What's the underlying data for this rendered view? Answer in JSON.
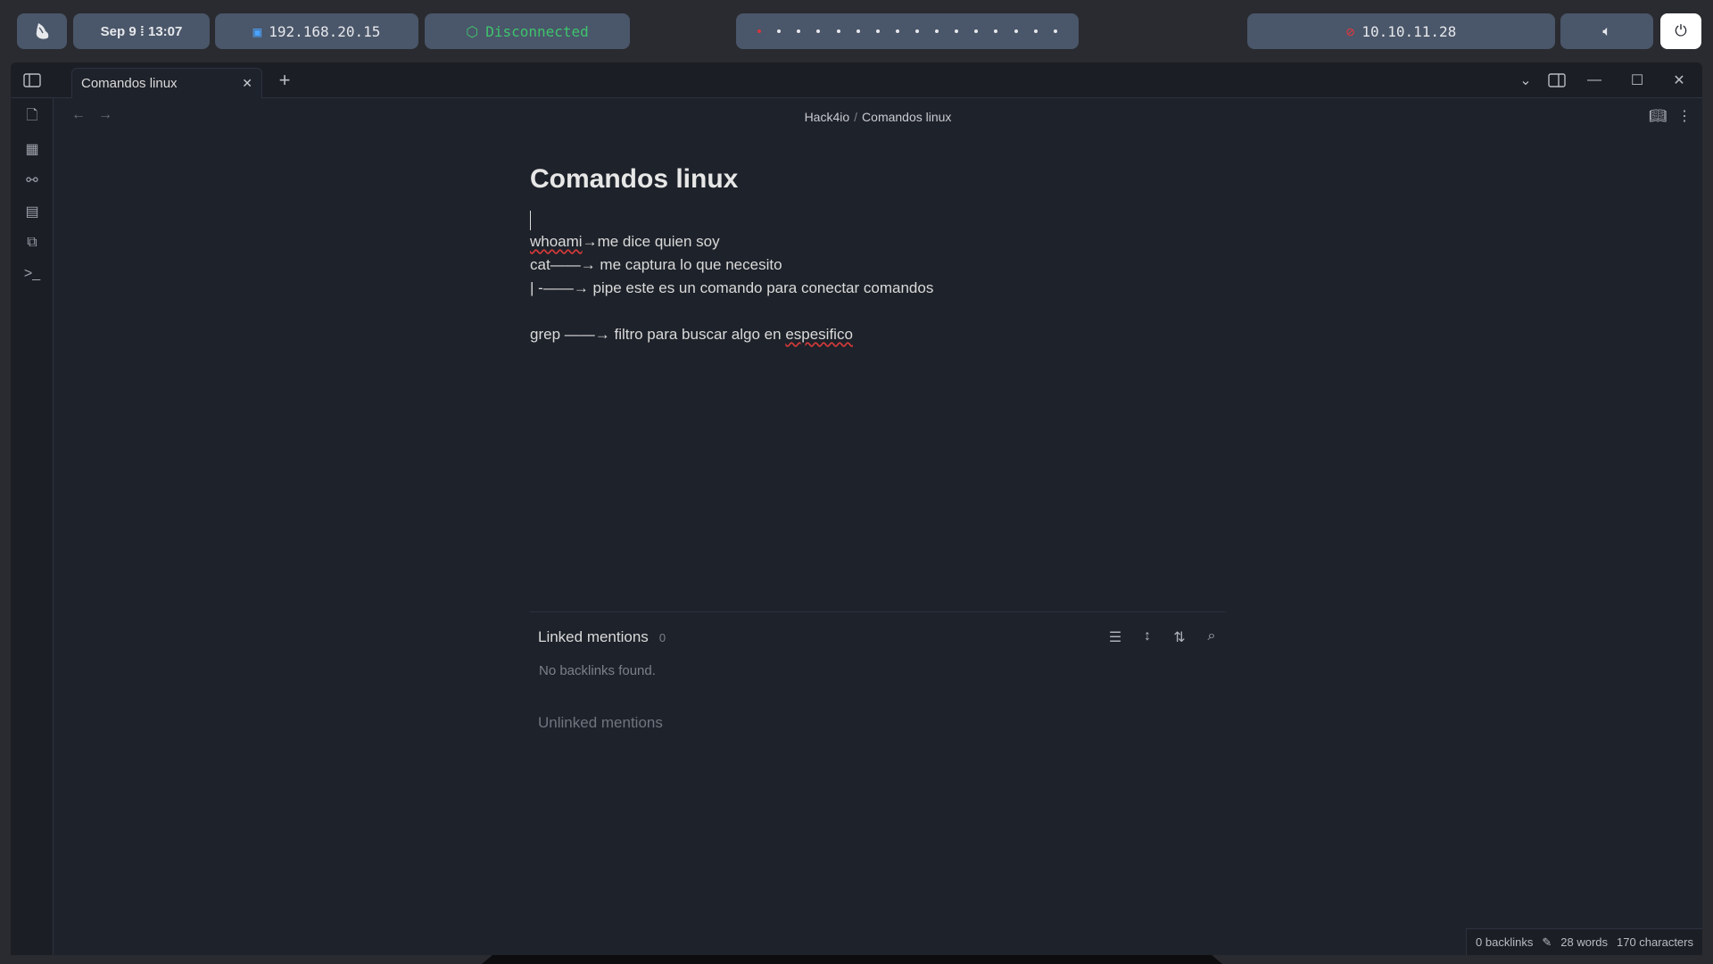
{
  "topbar": {
    "date": "Sep 9 ⁞ 13:07",
    "local_ip": "192.168.20.15",
    "vpn_status": "Disconnected",
    "target_ip": "10.10.11.28",
    "workspace_count": 16
  },
  "tab": {
    "title": "Comandos linux"
  },
  "breadcrumb": {
    "vault": "Hack4io",
    "separator": "/",
    "note": "Comandos linux"
  },
  "note": {
    "title": "Comandos linux",
    "lines": [
      {
        "cmd": "whoami",
        "rest": "→me dice quien soy"
      },
      {
        "cmd": "cat",
        "rest": "——→ me captura lo que necesito"
      },
      {
        "cmd": "| -",
        "rest": "——→ pipe este es un comando para conectar comandos"
      }
    ],
    "grep_line": {
      "prefix": "grep ——→ filtro para buscar algo en ",
      "misspelled": "espesifico"
    }
  },
  "backlinks": {
    "linked_title": "Linked mentions",
    "linked_count": "0",
    "empty_text": "No backlinks found.",
    "unlinked_title": "Unlinked mentions"
  },
  "status": {
    "backlinks": "0 backlinks",
    "words": "28 words",
    "characters": "170 characters"
  },
  "colors": {
    "accent_green": "#3ec46d",
    "accent_red": "#e0383e",
    "pill_bg": "#4a5669",
    "editor_bg": "#1e222a"
  }
}
